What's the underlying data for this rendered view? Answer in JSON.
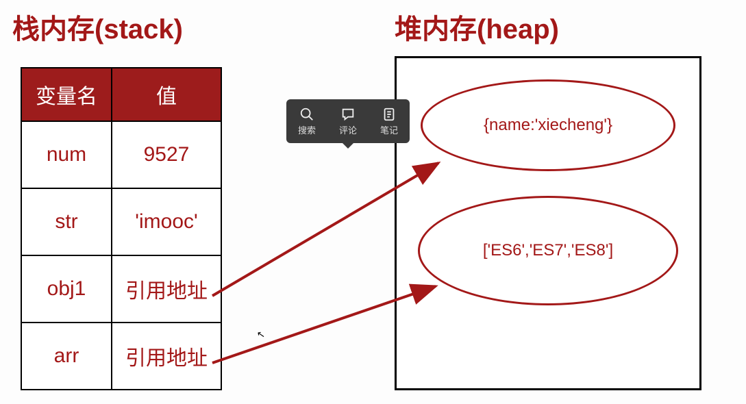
{
  "titles": {
    "stack": "栈内存(stack)",
    "heap": "堆内存(heap)"
  },
  "stack_table": {
    "header": {
      "var": "变量名",
      "val": "值"
    },
    "rows": [
      {
        "var": "num",
        "val": "9527"
      },
      {
        "var": "str",
        "val": "'imooc'"
      },
      {
        "var": "obj1",
        "val": "引用地址"
      },
      {
        "var": "arr",
        "val": "引用地址"
      }
    ]
  },
  "heap_items": {
    "object": "{name:'xiecheng'}",
    "array": "['ES6','ES7','ES8']"
  },
  "toolbar": {
    "search": "搜索",
    "comment": "评论",
    "note": "笔记"
  },
  "colors": {
    "primary": "#a31818",
    "table_header_bg": "#9d1c1c",
    "toolbar_bg": "#3a3a3a"
  }
}
